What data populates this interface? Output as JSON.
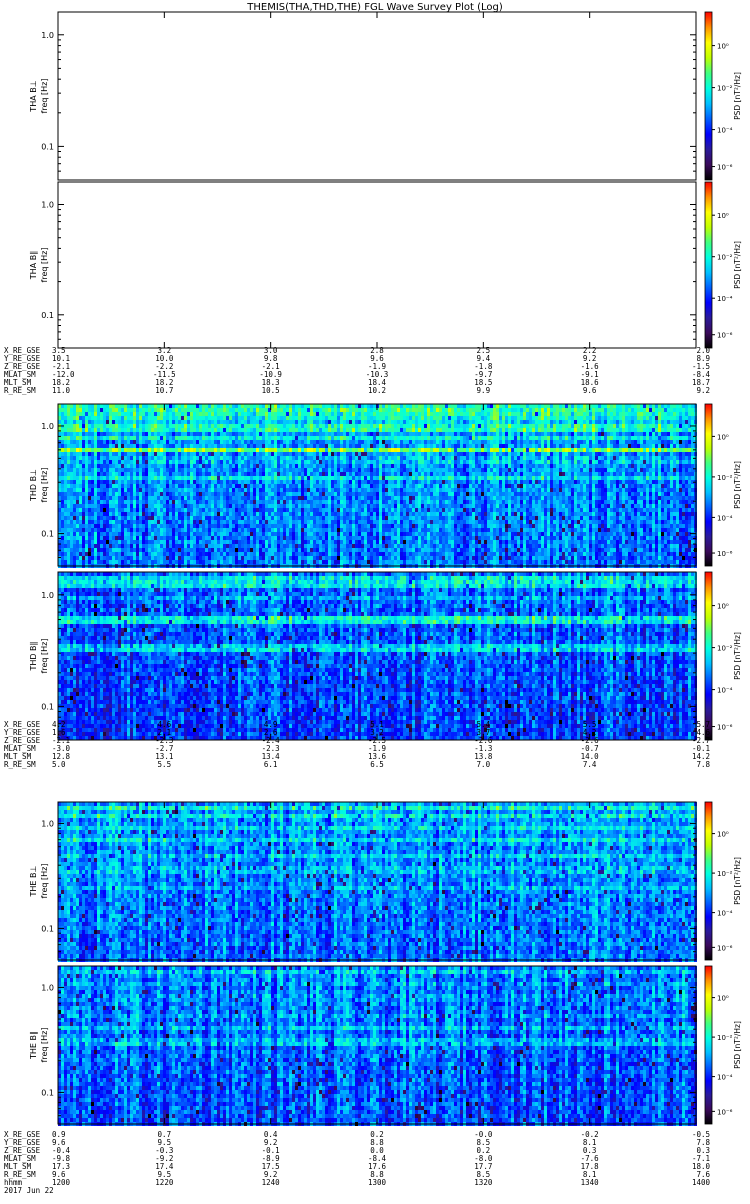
{
  "title": "THEMIS(THA,THD,THE) FGL Wave Survey Plot (Log)",
  "colorbar_label": "PSD [nT²/Hz]",
  "colors": {
    "colorbar": [
      "#000000",
      "#3a0a5a",
      "#2a1a9a",
      "#0000ff",
      "#0060ff",
      "#00c0ff",
      "#00ffe0",
      "#40ff80",
      "#c0ff00",
      "#ffff00",
      "#ff9000",
      "#ff0000"
    ],
    "frame": "#000000",
    "background": "#ffffff"
  },
  "chart_data": [
    {
      "type": "heatmap",
      "name": "THA B⊥",
      "panel_label": "THA B⊥",
      "ylabel": "freq [Hz]",
      "yscale": "log",
      "ylim": [
        0.05,
        1.6
      ],
      "yticks": [
        "1.0",
        "0.1"
      ],
      "cbticks": [
        "10⁰",
        "10⁻²",
        "10⁻⁴",
        "10⁻⁶"
      ],
      "empty": true
    },
    {
      "type": "heatmap",
      "name": "THA B∥",
      "panel_label": "THA B∥",
      "ylabel": "freq [Hz]",
      "yscale": "log",
      "ylim": [
        0.05,
        1.6
      ],
      "yticks": [
        "1.0",
        "0.1"
      ],
      "cbticks": [
        "10⁰",
        "10⁻²",
        "10⁻⁴",
        "10⁻⁶"
      ],
      "empty": true
    },
    {
      "type": "heatmap",
      "name": "THD B⊥",
      "panel_label": "THD B⊥",
      "ylabel": "freq [Hz]",
      "yscale": "log",
      "ylim": [
        0.05,
        1.6
      ],
      "yticks": [
        "1.0",
        "0.1"
      ],
      "cbticks": [
        "10⁰",
        "10⁻²",
        "10⁻⁴",
        "10⁻⁶"
      ],
      "empty": false,
      "base_level": 0.38,
      "bands": [
        {
          "freq": 1.45,
          "level": 0.62
        },
        {
          "freq": 1.25,
          "level": 0.6
        },
        {
          "freq": 1.1,
          "level": 0.5
        },
        {
          "freq": 0.95,
          "level": 0.62
        },
        {
          "freq": 0.78,
          "level": 0.55
        },
        {
          "freq": 0.6,
          "level": 0.68
        },
        {
          "freq": 0.48,
          "level": 0.5
        },
        {
          "freq": 0.33,
          "level": 0.52
        }
      ]
    },
    {
      "type": "heatmap",
      "name": "THD B∥",
      "panel_label": "THD B∥",
      "ylabel": "freq [Hz]",
      "yscale": "log",
      "ylim": [
        0.05,
        1.6
      ],
      "yticks": [
        "1.0",
        "0.1"
      ],
      "cbticks": [
        "10⁰",
        "10⁻²",
        "10⁻⁴",
        "10⁻⁶"
      ],
      "empty": false,
      "base_level": 0.32,
      "bands": [
        {
          "freq": 1.35,
          "level": 0.55
        },
        {
          "freq": 1.2,
          "level": 0.52
        },
        {
          "freq": 0.95,
          "level": 0.45
        },
        {
          "freq": 0.6,
          "level": 0.58
        },
        {
          "freq": 0.33,
          "level": 0.52
        }
      ]
    },
    {
      "type": "heatmap",
      "name": "THE B⊥",
      "panel_label": "THE B⊥",
      "ylabel": "freq [Hz]",
      "yscale": "log",
      "ylim": [
        0.05,
        1.6
      ],
      "yticks": [
        "1.0",
        "0.1"
      ],
      "cbticks": [
        "10⁰",
        "10⁻²",
        "10⁻⁴",
        "10⁻⁶"
      ],
      "empty": false,
      "base_level": 0.37,
      "bands": [
        {
          "freq": 1.4,
          "level": 0.55
        },
        {
          "freq": 1.15,
          "level": 0.55
        },
        {
          "freq": 0.9,
          "level": 0.5
        },
        {
          "freq": 0.7,
          "level": 0.52
        },
        {
          "freq": 0.5,
          "level": 0.5
        },
        {
          "freq": 0.36,
          "level": 0.5
        },
        {
          "freq": 0.25,
          "level": 0.48
        }
      ]
    },
    {
      "type": "heatmap",
      "name": "THE B∥",
      "panel_label": "THE B∥",
      "ylabel": "freq [Hz]",
      "yscale": "log",
      "ylim": [
        0.05,
        1.6
      ],
      "yticks": [
        "1.0",
        "0.1"
      ],
      "cbticks": [
        "10⁰",
        "10⁻²",
        "10⁻⁴",
        "10⁻⁶"
      ],
      "empty": false,
      "base_level": 0.34,
      "bands": [
        {
          "freq": 1.4,
          "level": 0.48
        },
        {
          "freq": 1.05,
          "level": 0.45
        },
        {
          "freq": 0.8,
          "level": 0.45
        },
        {
          "freq": 0.55,
          "level": 0.45
        },
        {
          "freq": 0.42,
          "level": 0.48
        },
        {
          "freq": 0.3,
          "level": 0.5
        }
      ]
    }
  ],
  "orbit_tables": [
    {
      "rows": [
        {
          "label": "X_RE_GSE",
          "values": [
            "3.5",
            "3.2",
            "3.0",
            "2.8",
            "2.5",
            "2.2",
            "2.0"
          ]
        },
        {
          "label": "Y_RE_GSE",
          "values": [
            "10.1",
            "10.0",
            "9.8",
            "9.6",
            "9.4",
            "9.2",
            "8.9"
          ]
        },
        {
          "label": "Z_RE_GSE",
          "values": [
            "-2.1",
            "-2.2",
            "-2.1",
            "-1.9",
            "-1.8",
            "-1.6",
            "-1.5"
          ]
        },
        {
          "label": "MLAT_SM",
          "values": [
            "-12.0",
            "-11.5",
            "-10.9",
            "-10.3",
            "-9.7",
            "-9.1",
            "-8.4"
          ]
        },
        {
          "label": "MLT_SM",
          "values": [
            "18.2",
            "18.2",
            "18.3",
            "18.4",
            "18.5",
            "18.6",
            "18.7"
          ]
        },
        {
          "label": "R_RE_SM",
          "values": [
            "11.0",
            "10.7",
            "10.5",
            "10.2",
            "9.9",
            "9.6",
            "9.2"
          ]
        }
      ]
    },
    {
      "rows": [
        {
          "label": "X_RE_GSE",
          "values": [
            "4.2",
            "4.6",
            "4.9",
            "5.1",
            "5.4",
            "5.5",
            "5.7"
          ]
        },
        {
          "label": "Y_RE_GSE",
          "values": [
            "1.6",
            "2.1",
            "2.6",
            "3.2",
            "3.7",
            "4.2",
            "4.6"
          ]
        },
        {
          "label": "Z_RE_GSE",
          "values": [
            "-2.1",
            "-2.3",
            "-2.4",
            "-2.5",
            "-2.6",
            "-2.6",
            "-2.7"
          ]
        },
        {
          "label": "MLAT_SM",
          "values": [
            "-3.0",
            "-2.7",
            "-2.3",
            "-1.9",
            "-1.3",
            "-0.7",
            "-0.1"
          ]
        },
        {
          "label": "MLT_SM",
          "values": [
            "12.8",
            "13.1",
            "13.4",
            "13.6",
            "13.8",
            "14.0",
            "14.2"
          ]
        },
        {
          "label": "R_RE_SM",
          "values": [
            "5.0",
            "5.5",
            "6.1",
            "6.5",
            "7.0",
            "7.4",
            "7.8"
          ]
        }
      ]
    },
    {
      "rows": [
        {
          "label": "X_RE_GSE",
          "values": [
            "0.9",
            "0.7",
            "0.4",
            "0.2",
            "-0.0",
            "-0.2",
            "-0.5"
          ]
        },
        {
          "label": "Y_RE_GSE",
          "values": [
            "9.6",
            "9.5",
            "9.2",
            "8.8",
            "8.5",
            "8.1",
            "7.8"
          ]
        },
        {
          "label": "Z_RE_GSE",
          "values": [
            "-0.4",
            "-0.3",
            "-0.1",
            "0.0",
            "0.2",
            "0.3",
            "0.3"
          ]
        },
        {
          "label": "MLAT_SM",
          "values": [
            "-9.8",
            "-9.2",
            "-8.9",
            "-8.4",
            "-8.0",
            "-7.6",
            "-7.1"
          ]
        },
        {
          "label": "MLT_SM",
          "values": [
            "17.3",
            "17.4",
            "17.5",
            "17.6",
            "17.7",
            "17.8",
            "18.0"
          ]
        },
        {
          "label": "R_RE_SM",
          "values": [
            "9.6",
            "9.5",
            "9.2",
            "8.8",
            "8.5",
            "8.1",
            "7.6"
          ]
        },
        {
          "label": "hhmm",
          "values": [
            "1200",
            "1220",
            "1240",
            "1300",
            "1320",
            "1340",
            "1400"
          ]
        }
      ],
      "date": "2017 Jun 22"
    }
  ]
}
